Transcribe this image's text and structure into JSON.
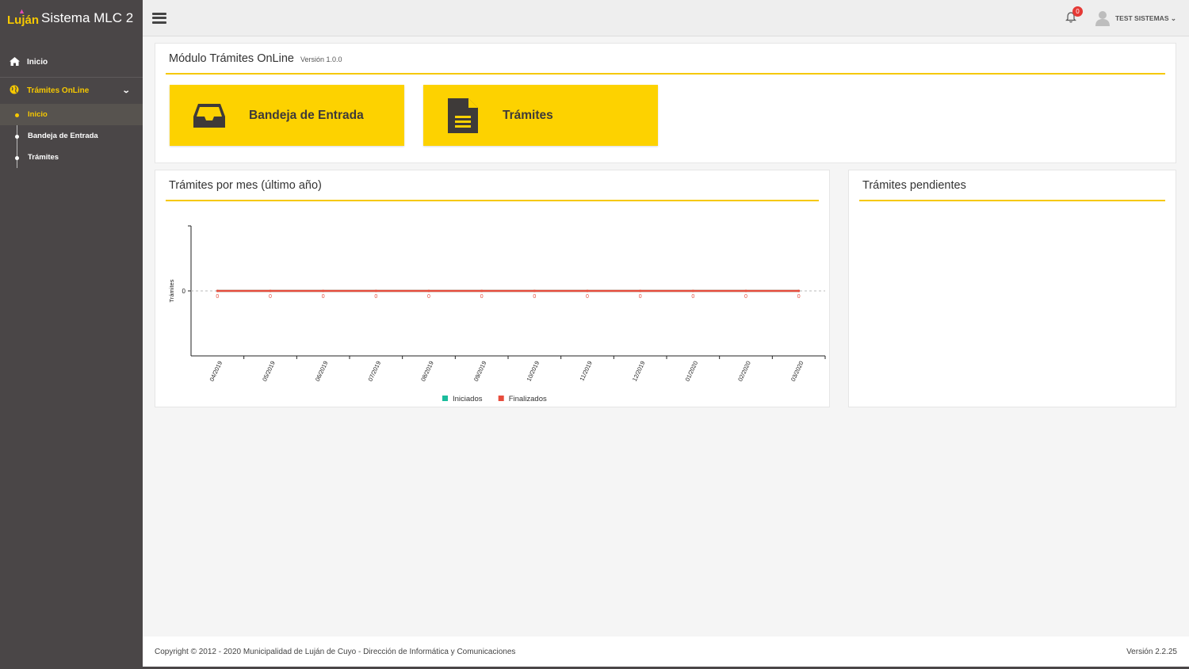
{
  "brand": {
    "logo": "Luján",
    "title": "Sistema MLC 2"
  },
  "sidebar": {
    "home_label": "Inicio",
    "group_label": "Trámites OnLine",
    "subitems": [
      {
        "label": "Inicio",
        "active": true
      },
      {
        "label": "Bandeja de Entrada",
        "active": false
      },
      {
        "label": "Trámites",
        "active": false
      }
    ]
  },
  "topbar": {
    "notifications_count": "0",
    "user_name": "TEST SISTEMAS"
  },
  "module": {
    "title": "Módulo Trámites OnLine",
    "version": "Versión 1.0.0",
    "tiles": [
      {
        "label": "Bandeja de Entrada",
        "icon": "inbox-icon"
      },
      {
        "label": "Trámites",
        "icon": "document-icon"
      }
    ]
  },
  "chart_panel": {
    "title": "Trámites por mes (último año)"
  },
  "pending_panel": {
    "title": "Trámites pendientes"
  },
  "chart_data": {
    "type": "line",
    "ylabel": "Trámites",
    "ytick_labels": [
      "0"
    ],
    "categories": [
      "04/2019",
      "05/2019",
      "06/2019",
      "07/2019",
      "08/2019",
      "09/2019",
      "10/2019",
      "11/2019",
      "12/2019",
      "01/2020",
      "02/2020",
      "03/2020"
    ],
    "series": [
      {
        "name": "Iniciados",
        "color": "#1abc9c",
        "values": [
          0,
          0,
          0,
          0,
          0,
          0,
          0,
          0,
          0,
          0,
          0,
          0
        ]
      },
      {
        "name": "Finalizados",
        "color": "#e74c3c",
        "values": [
          0,
          0,
          0,
          0,
          0,
          0,
          0,
          0,
          0,
          0,
          0,
          0
        ]
      }
    ],
    "legend_position": "bottom"
  },
  "footer": {
    "copyright": "Copyright © 2012 - 2020 Municipalidad de Luján de Cuyo - Dirección de Informática y Comunicaciones",
    "version": "Versión 2.2.25"
  }
}
